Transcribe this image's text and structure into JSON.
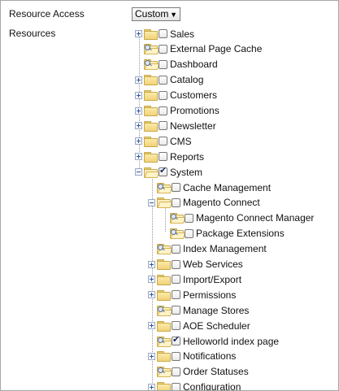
{
  "form": {
    "resource_access_label": "Resource Access",
    "resource_access_value": "Custom",
    "resources_label": "Resources"
  },
  "tree": [
    {
      "label": "Sales",
      "level": 0,
      "expander": "plus",
      "folder": "closed",
      "checked": false
    },
    {
      "label": "External Page Cache",
      "level": 0,
      "expander": "none",
      "folder": "leaf",
      "checked": false
    },
    {
      "label": "Dashboard",
      "level": 0,
      "expander": "none",
      "folder": "leaf",
      "checked": false
    },
    {
      "label": "Catalog",
      "level": 0,
      "expander": "plus",
      "folder": "closed",
      "checked": false
    },
    {
      "label": "Customers",
      "level": 0,
      "expander": "plus",
      "folder": "closed",
      "checked": false
    },
    {
      "label": "Promotions",
      "level": 0,
      "expander": "plus",
      "folder": "closed",
      "checked": false
    },
    {
      "label": "Newsletter",
      "level": 0,
      "expander": "plus",
      "folder": "closed",
      "checked": false
    },
    {
      "label": "CMS",
      "level": 0,
      "expander": "plus",
      "folder": "closed",
      "checked": false
    },
    {
      "label": "Reports",
      "level": 0,
      "expander": "plus",
      "folder": "closed",
      "checked": false
    },
    {
      "label": "System",
      "level": 0,
      "expander": "minus",
      "folder": "open",
      "checked": true
    },
    {
      "label": "Cache Management",
      "level": 1,
      "expander": "none",
      "folder": "leaf",
      "checked": false
    },
    {
      "label": "Magento Connect",
      "level": 1,
      "expander": "minus",
      "folder": "open",
      "checked": false
    },
    {
      "label": "Magento Connect Manager",
      "level": 2,
      "expander": "none",
      "folder": "leaf",
      "checked": false
    },
    {
      "label": "Package Extensions",
      "level": 2,
      "expander": "none",
      "folder": "leaf",
      "checked": false
    },
    {
      "label": "Index Management",
      "level": 1,
      "expander": "none",
      "folder": "leaf",
      "checked": false
    },
    {
      "label": "Web Services",
      "level": 1,
      "expander": "plus",
      "folder": "closed",
      "checked": false
    },
    {
      "label": "Import/Export",
      "level": 1,
      "expander": "plus",
      "folder": "closed",
      "checked": false
    },
    {
      "label": "Permissions",
      "level": 1,
      "expander": "plus",
      "folder": "closed",
      "checked": false
    },
    {
      "label": "Manage Stores",
      "level": 1,
      "expander": "none",
      "folder": "leaf",
      "checked": false
    },
    {
      "label": "AOE Scheduler",
      "level": 1,
      "expander": "plus",
      "folder": "closed",
      "checked": false
    },
    {
      "label": "Helloworld index page",
      "level": 1,
      "expander": "none",
      "folder": "leaf",
      "checked": true
    },
    {
      "label": "Notifications",
      "level": 1,
      "expander": "plus",
      "folder": "closed",
      "checked": false
    },
    {
      "label": "Order Statuses",
      "level": 1,
      "expander": "none",
      "folder": "leaf",
      "checked": false
    },
    {
      "label": "Configuration",
      "level": 1,
      "expander": "plus",
      "folder": "closed",
      "checked": false
    }
  ]
}
